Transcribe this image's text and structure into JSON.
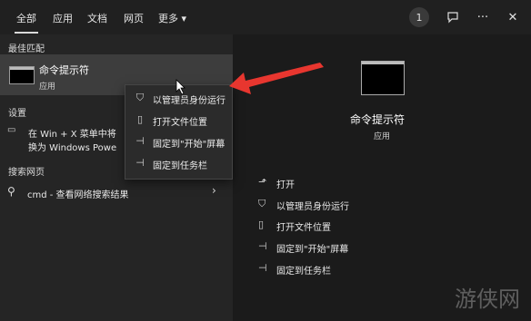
{
  "tabs": [
    {
      "label": "全部"
    },
    {
      "label": "应用"
    },
    {
      "label": "文档"
    },
    {
      "label": "网页"
    },
    {
      "label": "更多 ▾"
    }
  ],
  "topbar": {
    "count": "1",
    "feedback_icon": "feedback-icon",
    "more_icon": "ellipsis-icon",
    "close_icon": "close-icon"
  },
  "left": {
    "best_match_header": "最佳匹配",
    "best_match": {
      "title": "命令提示符",
      "subtitle": "应用"
    },
    "settings_header": "设置",
    "setting_line1": "在 Win + X 菜单中将",
    "setting_line2": "换为 Windows Powe",
    "web_header": "搜索网页",
    "web_result": "cmd - 查看网络搜索结果"
  },
  "context_menu": [
    {
      "label": "以管理员身份运行",
      "icon": "shield-icon"
    },
    {
      "label": "打开文件位置",
      "icon": "folder-icon"
    },
    {
      "label": "固定到\"开始\"屏幕",
      "icon": "pin-icon"
    },
    {
      "label": "固定到任务栏",
      "icon": "pin-icon"
    }
  ],
  "detail": {
    "title": "命令提示符",
    "subtitle": "应用",
    "actions": [
      {
        "label": "打开",
        "icon": "open-icon"
      },
      {
        "label": "以管理员身份运行",
        "icon": "shield-icon"
      },
      {
        "label": "打开文件位置",
        "icon": "folder-icon"
      },
      {
        "label": "固定到\"开始\"屏幕",
        "icon": "pin-icon"
      },
      {
        "label": "固定到任务栏",
        "icon": "pin-icon"
      }
    ]
  },
  "watermark": "游侠网",
  "colors": {
    "arrow": "#e8362f",
    "highlight": "#3d3d3d"
  }
}
